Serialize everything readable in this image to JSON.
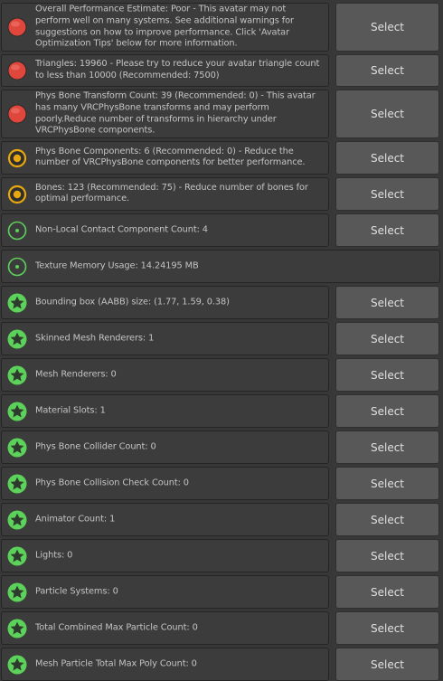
{
  "colors": {
    "error": "#e0473c",
    "warning": "#e8a70f",
    "info": "#5cd25b",
    "good": "#5cd25b"
  },
  "select_label": "Select",
  "rows": [
    {
      "icon": "error",
      "has_select": true,
      "text": "Overall Performance Estimate: Poor - This avatar may not perform well on many systems. See additional warnings for suggestions on how to improve performance. Click 'Avatar Optimization Tips' below for more information."
    },
    {
      "icon": "error",
      "has_select": true,
      "text": "Triangles: 19960 - Please try to reduce your avatar triangle count to less than 10000 (Recommended: 7500)"
    },
    {
      "icon": "error",
      "has_select": true,
      "text": "Phys Bone Transform Count: 39 (Recommended: 0) - This avatar has many VRCPhysBone transforms and may perform poorly.Reduce number of transforms in hierarchy under VRCPhysBone components."
    },
    {
      "icon": "warning",
      "has_select": true,
      "text": "Phys Bone Components: 6 (Recommended: 0) - Reduce the number of VRCPhysBone components for better performance."
    },
    {
      "icon": "warning",
      "has_select": true,
      "text": "Bones: 123 (Recommended: 75) - Reduce number of bones for optimal performance."
    },
    {
      "icon": "info",
      "has_select": true,
      "text": "Non-Local Contact Component Count: 4"
    },
    {
      "icon": "info",
      "has_select": false,
      "text": "Texture Memory Usage: 14.24195 MB"
    },
    {
      "icon": "good",
      "has_select": true,
      "text": "Bounding box (AABB) size: (1.77, 1.59, 0.38)"
    },
    {
      "icon": "good",
      "has_select": true,
      "text": "Skinned Mesh Renderers: 1"
    },
    {
      "icon": "good",
      "has_select": true,
      "text": "Mesh Renderers: 0"
    },
    {
      "icon": "good",
      "has_select": true,
      "text": "Material Slots: 1"
    },
    {
      "icon": "good",
      "has_select": true,
      "text": "Phys Bone Collider Count: 0"
    },
    {
      "icon": "good",
      "has_select": true,
      "text": "Phys Bone Collision Check Count: 0"
    },
    {
      "icon": "good",
      "has_select": true,
      "text": "Animator Count: 1"
    },
    {
      "icon": "good",
      "has_select": true,
      "text": "Lights: 0"
    },
    {
      "icon": "good",
      "has_select": true,
      "text": "Particle Systems: 0"
    },
    {
      "icon": "good",
      "has_select": true,
      "text": "Total Combined Max Particle Count: 0"
    },
    {
      "icon": "good",
      "has_select": true,
      "text": "Mesh Particle Total Max Poly Count: 0"
    }
  ]
}
